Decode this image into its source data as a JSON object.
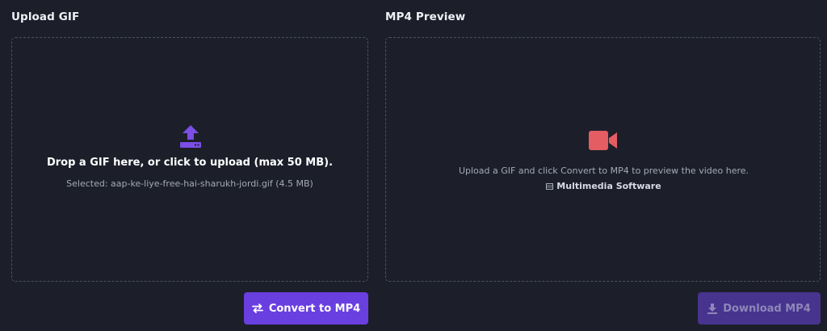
{
  "upload": {
    "title": "Upload GIF",
    "drop_text": "Drop a GIF here, or click to upload (max 50 MB).",
    "selected_text": "Selected: aap-ke-liye-free-hai-sharukh-jordi.gif (4.5 MB)",
    "icon": "upload-icon"
  },
  "preview": {
    "title": "MP4 Preview",
    "placeholder_text": "Upload a GIF and click Convert to MP4 to preview the video here.",
    "link_text": "Multimedia Software",
    "icon": "video-camera-icon"
  },
  "actions": {
    "convert_label": "Convert to MP4",
    "download_label": "Download MP4",
    "download_enabled": false
  },
  "colors": {
    "background": "#1c1f2a",
    "accent": "#6a3fe0",
    "accent_disabled": "#46348f",
    "camera_icon": "#e35d63",
    "upload_icon": "#7b4ee6"
  }
}
